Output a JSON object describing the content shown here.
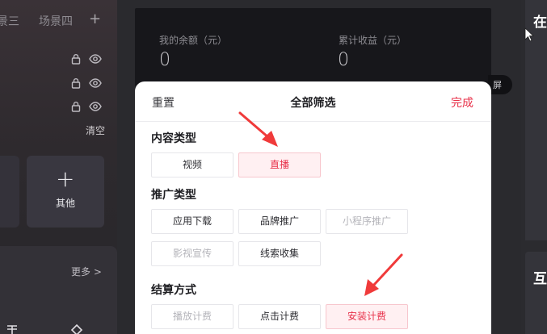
{
  "left": {
    "scene_tab_3": "景三",
    "scene_tab_4": "场景四",
    "add_symbol": "+",
    "clear": "清空",
    "other_plus": "+",
    "other_label": "其他",
    "more": "更多 >"
  },
  "stats": {
    "balance_label": "我的余额（元）",
    "balance_value": "0",
    "earnings_label": "累计收益（元）",
    "earnings_value": "0"
  },
  "right": {
    "char_top": "在",
    "char_bottom": "互",
    "pill_text": "屏"
  },
  "sheet": {
    "reset": "重置",
    "title": "全部筛选",
    "done": "完成",
    "sections": [
      {
        "title": "内容类型",
        "chips": [
          "视频",
          "直播"
        ]
      },
      {
        "title": "推广类型",
        "chips": [
          "应用下载",
          "品牌推广",
          "小程序推广",
          "影视宣传",
          "线索收集"
        ]
      },
      {
        "title": "结算方式",
        "chips": [
          "播放计费",
          "点击计费",
          "安装计费"
        ]
      }
    ]
  },
  "colors": {
    "accent": "#e8314a",
    "selected_bg": "#fff0f2",
    "annotation_arrow": "#f03a3a"
  },
  "icons": [
    "lock-icon",
    "eye-icon",
    "plus-icon",
    "cursor-icon",
    "chevron-right-icon"
  ]
}
